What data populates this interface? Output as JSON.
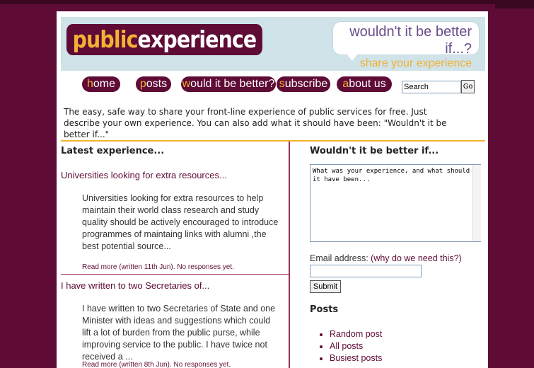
{
  "colors": {
    "brand": "#5e0b35",
    "accent": "#f2b134",
    "header_bg": "#cfe3e8"
  },
  "header": {
    "logo_a": "public",
    "logo_b": "experience",
    "tagline_1": "wouldn't it be better if...?",
    "tagline_2": "share your experience"
  },
  "nav": [
    {
      "first": "h",
      "rest": "ome"
    },
    {
      "first": "p",
      "rest": "osts"
    },
    {
      "first": "w",
      "rest": "ould it be better?"
    },
    {
      "first": "s",
      "rest": "ubscribe"
    },
    {
      "first": "a",
      "rest": "bout us"
    }
  ],
  "search": {
    "value": "Search",
    "go_label": "Go"
  },
  "intro": "The easy, safe way to share your front-line experience of public services for free. Just describe your own experience. You can also add what it should have been: \"Wouldn't it be better if...\"",
  "latest": {
    "heading": "Latest experience...",
    "posts": [
      {
        "title": "Universities looking for extra resources...",
        "body": "Universities looking for extra resources to help maintain their world class research and study quality should be actively encouraged to introduce programmes of maintaing links with alumni ,the best potential source...",
        "read_more": "Read more",
        "meta": " (written 11th Jun). No responses yet."
      },
      {
        "title": "I have written to two Secretaries of...",
        "body": "I have written to two Secretaries of State and one Minister with ideas and suggestions which could lift a lot of burden from the public purse, while improving service to the public. I have twice not received a ...",
        "read_more": "Read more",
        "meta": " (written 8th Jun). No responses yet."
      }
    ]
  },
  "sidebar": {
    "heading": "Wouldn't it be better if...",
    "textarea_value": "What was your experience, and what should it have been...",
    "email_label": "Email address: ",
    "email_why": "(why do we need this?)",
    "submit_label": "Submit",
    "posts_heading": "Posts",
    "posts_links": [
      "Random post",
      "All posts",
      "Busiest posts"
    ]
  }
}
